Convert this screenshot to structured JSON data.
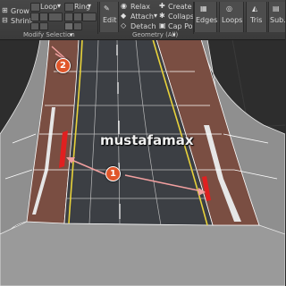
{
  "ribbon": {
    "grow_label": "Grow",
    "shrink_label": "Shrink",
    "loop_label": "Loop",
    "ring_label": "Ring",
    "edit_label": "Edit",
    "relax_label": "Relax",
    "attach_label": "Attach",
    "detach_label": "Detach",
    "create_label": "Create",
    "collapse_label": "Collapse",
    "cap_poly_label": "Cap Poly",
    "edges_label": "Edges",
    "loops_label": "Loops",
    "tris_label": "Tris",
    "sub_label": "Sub.",
    "modify_selection_label": "Modify Selection",
    "geometry_label": "Geometry (All)"
  },
  "viewport": {
    "watermark": "mustafamax",
    "callout_1": "1",
    "callout_2": "2"
  },
  "colors": {
    "asphalt": "#3c3f44",
    "curb": "#7a4e42",
    "highlight": "#e02020",
    "yellow_line": "#e8d23a",
    "callout": "#e0562a"
  }
}
